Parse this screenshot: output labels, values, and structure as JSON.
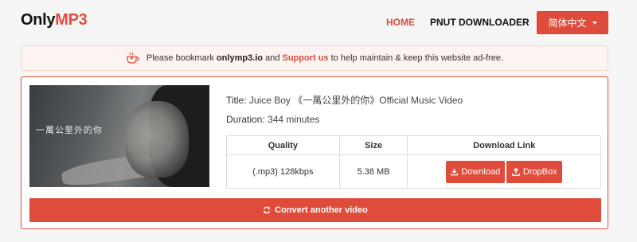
{
  "brand": {
    "part1": "Only",
    "part2": "MP3",
    "accent": "#e04c3c"
  },
  "nav": {
    "home": "HOME",
    "pnut": "PNUT DOWNLOADER",
    "language": "简体中文"
  },
  "notice": {
    "prefix": "Please bookmark",
    "site": "onlymp3.io",
    "and": "and",
    "support": "Support us",
    "suffix": "to help maintain & keep this website ad-free.",
    "icon": "coffee-heart-icon"
  },
  "video": {
    "title_label": "Title:",
    "title": "Juice Boy 《一萬公里外的你》Official Music Video",
    "duration_label": "Duration:",
    "duration": "344 minutes",
    "thumb_caption": "一萬公里外的你"
  },
  "table": {
    "headers": [
      "Quality",
      "Size",
      "Download Link"
    ],
    "rows": [
      {
        "quality": "(.mp3) 128kbps",
        "size": "5.38 MB",
        "download": "Download",
        "dropbox": "DropBox"
      }
    ]
  },
  "convert_label": "Convert another video"
}
